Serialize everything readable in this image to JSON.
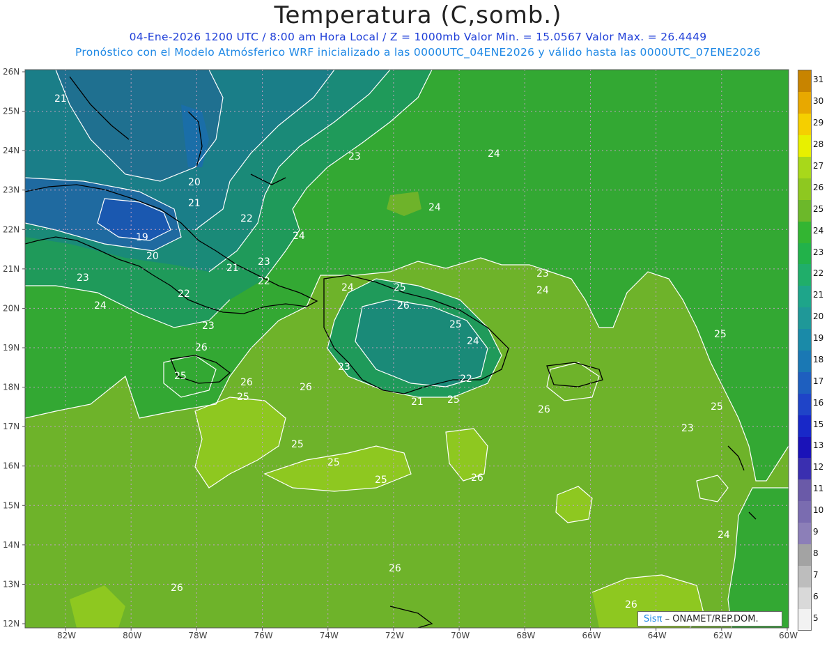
{
  "header": {
    "title": "Temperatura (C,somb.)",
    "line1": "04-Ene-2026  1200 UTC / 8:00 am Hora Local / Z = 1000mb    Valor Min. = 15.0567  Valor Max. = 26.4449",
    "line2": "Pronóstico con el Modelo Atmósferico WRF inicializado a las 0000UTC_04ENE2026 y válido hasta las  0000UTC_07ENE2026"
  },
  "map": {
    "lat_labels": [
      "26N",
      "25N",
      "24N",
      "23N",
      "22N",
      "21N",
      "20N",
      "19N",
      "18N",
      "17N",
      "16N",
      "15N",
      "14N",
      "13N",
      "12N"
    ],
    "lon_labels": [
      "82W",
      "80W",
      "78W",
      "76W",
      "74W",
      "72W",
      "70W",
      "68W",
      "66W",
      "64W",
      "62W",
      "60W"
    ],
    "contour_labels": [
      "21",
      "20",
      "21",
      "22",
      "24",
      "19",
      "20",
      "21",
      "23",
      "22",
      "22",
      "23",
      "24",
      "23",
      "23",
      "24",
      "24",
      "25",
      "26",
      "25",
      "24",
      "23",
      "22",
      "21",
      "24",
      "23",
      "24",
      "25",
      "25",
      "23",
      "24",
      "25",
      "25",
      "25",
      "25",
      "25",
      "26",
      "26",
      "26",
      "26",
      "26",
      "26",
      "26",
      "25",
      "26"
    ]
  },
  "colorbar": {
    "levels": [
      "5",
      "6",
      "7",
      "8",
      "9",
      "10",
      "11",
      "12",
      "13",
      "15",
      "16",
      "17",
      "18",
      "19",
      "20",
      "21",
      "22",
      "23",
      "24",
      "25",
      "26",
      "27",
      "28",
      "29",
      "30",
      "31"
    ],
    "colors": [
      "#f2f2f2",
      "#d9d9d9",
      "#bdbdbd",
      "#a3a3a3",
      "#8c7fb8",
      "#7a6cb0",
      "#6a5aa8",
      "#3a2fb0",
      "#1a12b8",
      "#1828c8",
      "#1f44c8",
      "#1e5fbf",
      "#1a78b4",
      "#1a8aa8",
      "#1f9898",
      "#1ea58a",
      "#20ae6a",
      "#22b24a",
      "#33b532",
      "#6cb82a",
      "#8ec820",
      "#a8d81a",
      "#e8f000",
      "#f5cf00",
      "#e8a800",
      "#c88400"
    ]
  },
  "attribution": {
    "sis": "Sisπ",
    "text": "– ONAMET/REP.DOM."
  }
}
